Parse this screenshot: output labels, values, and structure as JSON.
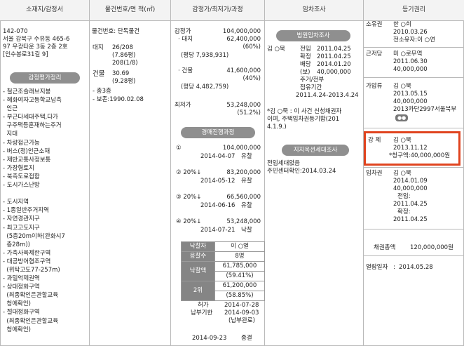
{
  "headers": [
    "소재지/감정서",
    "물건번호/면 적(㎡)",
    "감정가/최저가/과정",
    "임차조사",
    "등기권리"
  ],
  "location": {
    "zip": "142-070",
    "address1": "서울 강북구 수유동 465-6",
    "address2": "97 우광타운 3동 2층 2호",
    "address3": "[인수봉로31길 9]",
    "appraisal_button": "감정평가정리",
    "notes": [
      "- 철근조슬래브지붕",
      "- 혜화여자고등학교남측",
      "  인근",
      "- 부근다세대주택,다가",
      "  구주택등혼재하는주거",
      "  지대",
      "- 차량접근가능",
      "- 버스(정)인근소재",
      "- 제반교통사정보통",
      "- 가장형토지",
      "- 북측도로접함",
      "- 도시가스난방",
      "",
      "- 도시지역",
      "- 1종일반주거지역",
      "- 자연경관지구",
      "- 최고고도지구",
      "  (5층20m이하(완화시7",
      "  층28m))",
      "- 가축사육제한구역",
      "- 대공방어협조구역",
      "  (위탁고도77-257m)",
      "- 과밀억제권역",
      "- 상대정화구역",
      "  (최종확인은관할교육",
      "  청에확인)",
      "- 절대정화구역",
      "  (최종확인은관할교육",
      "  청에확인)"
    ]
  },
  "property": {
    "number": "물건번호: 단독물건",
    "land_label": "대지",
    "land_value": "26/208",
    "land_sub1": "(7.86평)",
    "land_sub2": "208(1/8)",
    "building_label": "건물",
    "building_value": "30.69",
    "building_sub": "(9.28평)",
    "floors": "- 총3층",
    "preserved": "- 보존:1990.02.08"
  },
  "price": {
    "appraisal_label": "감정가",
    "appraisal_value": "104,000,000",
    "land_label": "· 대지",
    "land_value": "62,400,000",
    "land_pct": "(60%)",
    "land_per_pyeong": "(평당 7,938,931)",
    "bldg_label": "· 건물",
    "bldg_value": "41,600,000",
    "bldg_pct": "(40%)",
    "bldg_per_pyeong": "(평당 4,482,759)",
    "min_label": "최저가",
    "min_value": "53,248,000",
    "min_pct": "(51.2%)",
    "process_button": "경매진행과정",
    "rounds": [
      {
        "no": "①",
        "amount": "104,000,000",
        "date": "2014-04-07",
        "result": "유찰"
      },
      {
        "no": "② 20%↓",
        "amount": "83,200,000",
        "date": "2014-05-12",
        "result": "유찰"
      },
      {
        "no": "③ 20%↓",
        "amount": "66,560,000",
        "date": "2014-06-16",
        "result": "유찰"
      },
      {
        "no": "④ 20%↓",
        "amount": "53,248,000",
        "date": "2014-07-21",
        "result": "낙찰"
      }
    ],
    "auction": [
      {
        "label": "낙찰자",
        "value": "이 ○열"
      },
      {
        "label": "응찰수",
        "value": "8명"
      },
      {
        "label": "낙찰액",
        "value": "61,785,000"
      },
      {
        "label": "",
        "value": "(59.41%)"
      },
      {
        "label": "2위",
        "value": "61,200,000"
      },
      {
        "label": "",
        "value": "(58.85%)"
      }
    ],
    "permit_label": "허가",
    "permit_date": "2014-07-28",
    "deadline_label": "납부기한",
    "deadline_date": "2014-09-03",
    "deadline_note": "(납부완료)",
    "end_date": "2014-09-23",
    "end_result": "종결"
  },
  "tenant": {
    "button": "법원임차조사",
    "name": "김 ○묵",
    "rows": [
      {
        "k": "전입",
        "v": "2011.04.25"
      },
      {
        "k": "확정",
        "v": "2011.04.25"
      },
      {
        "k": "배당",
        "v": "2014.01.20"
      },
      {
        "k": "(보)",
        "v": "40,000,000"
      }
    ],
    "usage": "주거/전부",
    "period_label": "점유기간",
    "period": "2011.4.24-2013.4.24",
    "note1": "*김 ○묵 : 이 사건 신청채권자",
    "note2": "이며, 주택임차권등기함(201",
    "note3": "4.1.9.)",
    "census_button": "지지옥션세대조사",
    "census_line1": "전입세대없음",
    "census_line2": "주민센터확인:2014.03.24"
  },
  "rights": {
    "owner_label": "소유권",
    "owner_name": "한 ○희",
    "owner_date": "2010.03.26",
    "owner_prev": "전소유자:이 ○연",
    "mortgage_label": "근저당",
    "mortgage_name": "미 ○로무역",
    "mortgage_date": "2011.06.30",
    "mortgage_amount": "40,000,000",
    "seizure_label": "가압류",
    "seizure_name": "김 ○묵",
    "seizure_date": "2013.05.15",
    "seizure_amount": "40,000,000",
    "seizure_case": "2013카단2997서울북부",
    "more_badge": "●●",
    "auction_label": "강 제",
    "auction_name": "김 ○묵",
    "auction_date": "2013.11.12",
    "auction_claim": "*청구액:40,000,000원",
    "lease_label": "임차권",
    "lease_name": "김 ○묵",
    "lease_date": "2014.01.09",
    "lease_amount": "40,000,000",
    "lease_move_label": "전입:",
    "lease_move": "2011.04.25",
    "lease_fix_label": "확정:",
    "lease_fix": "2011.04.25",
    "total_label": "채권총액",
    "total_value": "120,000,000원",
    "read_label": "열람일자",
    "read_value": "2014.05.28"
  },
  "colors": {
    "header_bg": "#f3f3f3",
    "button_bg": "#8f8f8f",
    "table_label_bg": "#858585",
    "highlight": "#e0441f",
    "border": "#b9b9b9"
  }
}
